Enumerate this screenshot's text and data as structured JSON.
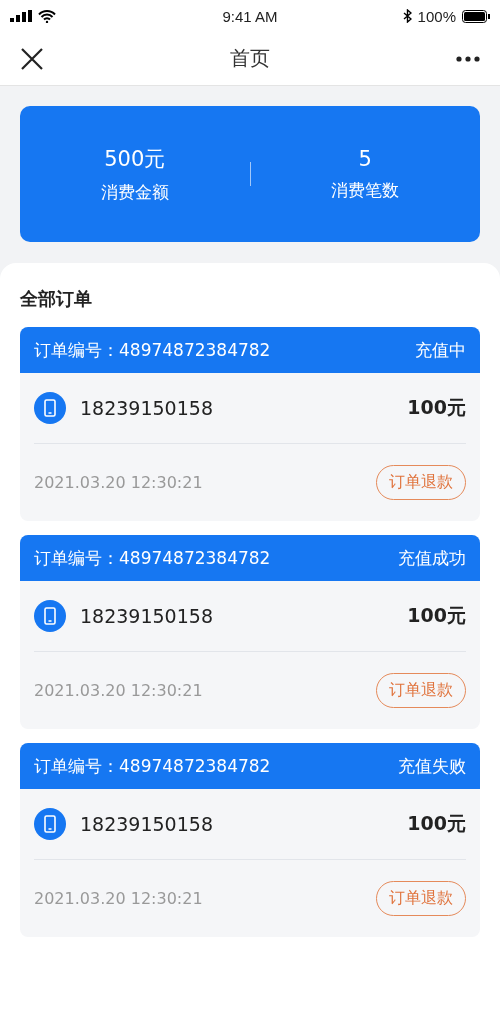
{
  "status_bar": {
    "time": "9:41 AM",
    "battery": "100%"
  },
  "nav": {
    "title": "首页"
  },
  "summary": [
    {
      "value": "500元",
      "label": "消费金额"
    },
    {
      "value": "5",
      "label": "消费笔数"
    }
  ],
  "orders_title": "全部订单",
  "orders": [
    {
      "number": "订单编号：48974872384782",
      "status": "充值中",
      "phone": "18239150158",
      "amount": "100元",
      "time": "2021.03.20 12:30:21",
      "action": "订单退款"
    },
    {
      "number": "订单编号：48974872384782",
      "status": "充值成功",
      "phone": "18239150158",
      "amount": "100元",
      "time": "2021.03.20 12:30:21",
      "action": "订单退款"
    },
    {
      "number": "订单编号：48974872384782",
      "status": "充值失败",
      "phone": "18239150158",
      "amount": "100元",
      "time": "2021.03.20 12:30:21",
      "action": "订单退款"
    }
  ]
}
